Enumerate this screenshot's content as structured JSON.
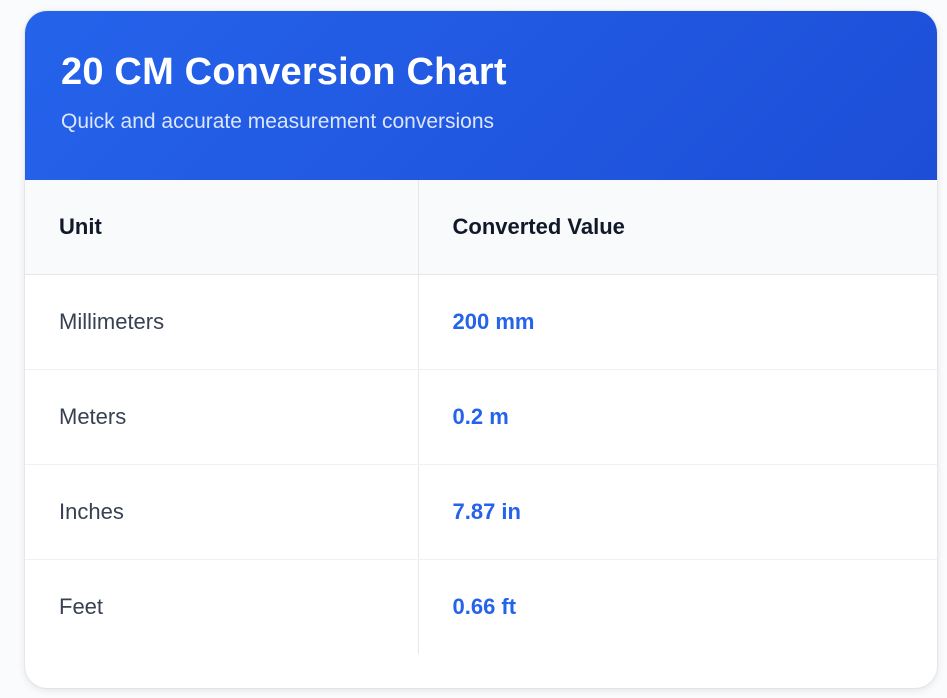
{
  "card": {
    "title": "20 CM Conversion Chart",
    "subtitle": "Quick and accurate measurement conversions"
  },
  "table": {
    "headers": [
      "Unit",
      "Converted Value"
    ],
    "rows": [
      {
        "unit": "Millimeters",
        "value": "200 mm"
      },
      {
        "unit": "Meters",
        "value": "0.2 m"
      },
      {
        "unit": "Inches",
        "value": "7.87 in"
      },
      {
        "unit": "Feet",
        "value": "0.66 ft"
      }
    ]
  },
  "colors": {
    "accent": "#2563eb",
    "header_gradient_end": "#1d4ed8",
    "header_row_bg": "#f8fafc"
  }
}
